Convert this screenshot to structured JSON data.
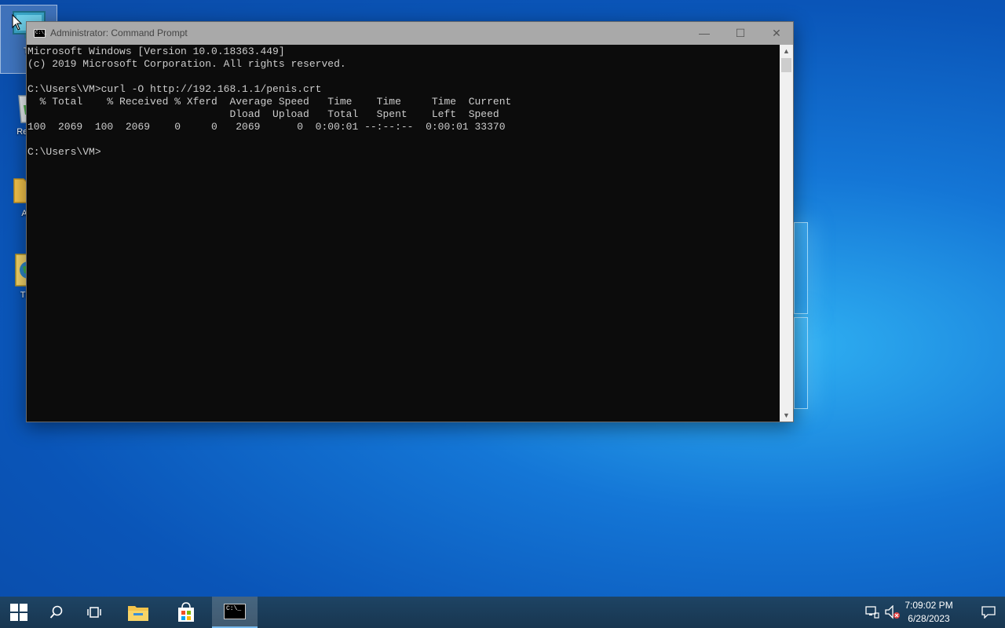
{
  "desktop": {
    "icons": [
      {
        "label": "Thi"
      },
      {
        "label": "Recyc"
      },
      {
        "label": "Acti"
      },
      {
        "label": "TEA"
      }
    ]
  },
  "window": {
    "title": "Administrator: Command Prompt",
    "app_icon_text": "C:\\_",
    "minimize_glyph": "—",
    "maximize_glyph": "☐",
    "close_glyph": "✕",
    "console_lines": [
      "Microsoft Windows [Version 10.0.18363.449]",
      "(c) 2019 Microsoft Corporation. All rights reserved.",
      "",
      "C:\\Users\\VM>curl -O http://192.168.1.1/penis.crt",
      "  % Total    % Received % Xferd  Average Speed   Time    Time     Time  Current",
      "                                 Dload  Upload   Total   Spent    Left  Speed",
      "100  2069  100  2069    0     0   2069      0  0:00:01 --:--:--  0:00:01 33370",
      "",
      "C:\\Users\\VM>"
    ]
  },
  "taskbar": {
    "start_icon": "windows-start-icon",
    "search_icon": "search-icon",
    "task_view_icon": "task-view-icon",
    "file_explorer_icon": "folder-icon",
    "store_icon": "store-bag-icon",
    "cmd_icon_text": "C:\\_",
    "tray": {
      "network_icon": "network-icon",
      "volume_icon": "volume-muted-icon",
      "time": "7:09:02 PM",
      "date": "6/28/2023",
      "notification_icon": "action-center-icon"
    }
  },
  "colors": {
    "console_bg": "#0c0c0c",
    "console_text": "#cccccc",
    "titlebar_inactive": "#a9a9a9",
    "taskbar": "#1c3d5a"
  }
}
